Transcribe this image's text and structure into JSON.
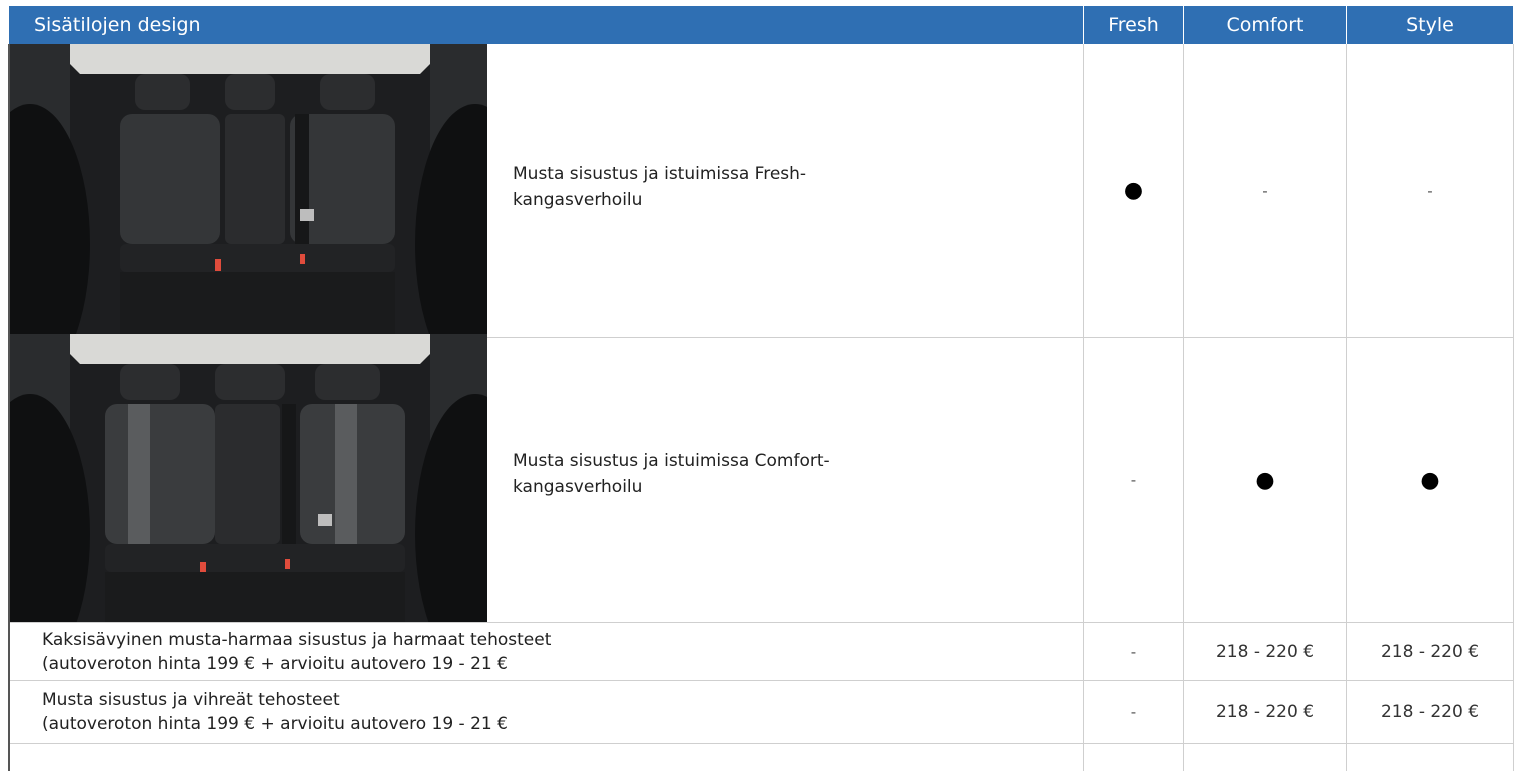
{
  "header": {
    "title": "Sisätilojen design",
    "columns": [
      "Fresh",
      "Comfort",
      "Style"
    ]
  },
  "rows": [
    {
      "image": "black-fabric-rear-seats-fresh",
      "text": "Musta sisustus ja istuimissa Fresh-kangasverhoilu",
      "line1": "Musta sisustus ja istuimissa Fresh-",
      "line2": "kangasverhoilu",
      "values": [
        "●",
        "-",
        "-"
      ]
    },
    {
      "image": "black-fabric-rear-seats-comfort",
      "text": "Musta sisustus ja istuimissa Comfort-kangasverhoilu",
      "line1": "Musta sisustus ja istuimissa Comfort-",
      "line2": "kangasverhoilu",
      "values": [
        "-",
        "●",
        "●"
      ]
    },
    {
      "line1": "Kaksisävyinen musta-harmaa sisustus ja harmaat tehosteet",
      "line2": "(autoveroton hinta 199 € + arvioitu autovero 19 - 21 €",
      "values": [
        "-",
        "218 - 220 €",
        "218 - 220 €"
      ]
    },
    {
      "line1": "Musta sisustus ja vihreät tehosteet",
      "line2": "(autoveroton hinta 199 € + arvioitu autovero 19 - 21 €",
      "values": [
        "-",
        "218 - 220 €",
        "218 - 220 €"
      ]
    }
  ],
  "colors": {
    "header_bg": "#2f6fb3",
    "header_text": "#ffffff",
    "grid": "#cfcfcf"
  }
}
